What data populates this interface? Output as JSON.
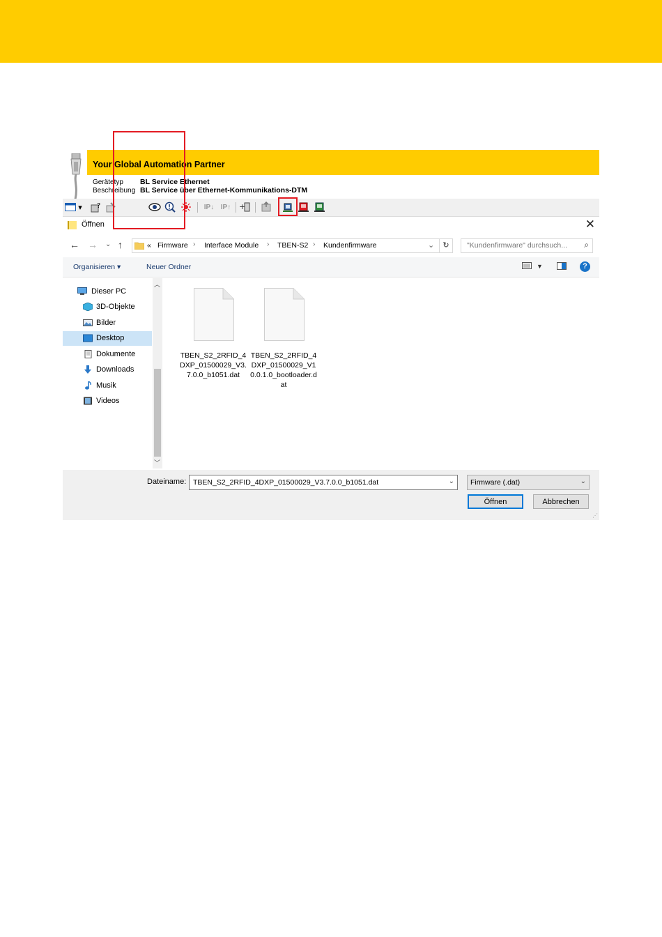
{
  "dtm": {
    "slogan": "Your Global Automation Partner",
    "rows": [
      {
        "label": "Gerätetyp",
        "value": "BL Service Ethernet"
      },
      {
        "label": "Beschreibung",
        "value": "BL Service über Ethernet-Kommunikations-DTM"
      }
    ]
  },
  "dialog": {
    "title": "Öffnen",
    "close": "✕",
    "breadcrumb": [
      "«",
      "Firmware",
      "Interface Module",
      "TBEN-S2",
      "Kundenfirmware"
    ],
    "search_placeholder": "\"Kundenfirmware\" durchsuch...",
    "commands": {
      "organize": "Organisieren ▾",
      "new_folder": "Neuer Ordner"
    },
    "help": "?",
    "tree": [
      {
        "label": "Dieser PC",
        "icon": "computer-icon",
        "selected": false
      },
      {
        "label": "3D-Objekte",
        "icon": "cube-icon",
        "selected": false
      },
      {
        "label": "Bilder",
        "icon": "pictures-icon",
        "selected": false
      },
      {
        "label": "Desktop",
        "icon": "desktop-icon",
        "selected": true
      },
      {
        "label": "Dokumente",
        "icon": "document-icon",
        "selected": false
      },
      {
        "label": "Downloads",
        "icon": "download-icon",
        "selected": false
      },
      {
        "label": "Musik",
        "icon": "music-icon",
        "selected": false
      },
      {
        "label": "Videos",
        "icon": "video-icon",
        "selected": false
      }
    ],
    "files": [
      {
        "name": "TBEN_S2_2RFID_4DXP_01500029_V3.7.0.0_b1051.dat",
        "selected": true
      },
      {
        "name": "TBEN_S2_2RFID_4DXP_01500029_V10.0.1.0_bootloader.dat",
        "selected": false
      }
    ],
    "filename_label": "Dateiname:",
    "filename_value": "TBEN_S2_2RFID_4DXP_01500029_V3.7.0.0_b1051.dat",
    "filter_value": "Firmware (.dat)",
    "open_button": "Öffnen",
    "cancel_button": "Abbrechen"
  },
  "colors": {
    "brand_yellow": "#ffcc00",
    "highlight_red": "#e31b23",
    "selection_blue": "#cce4f7"
  }
}
